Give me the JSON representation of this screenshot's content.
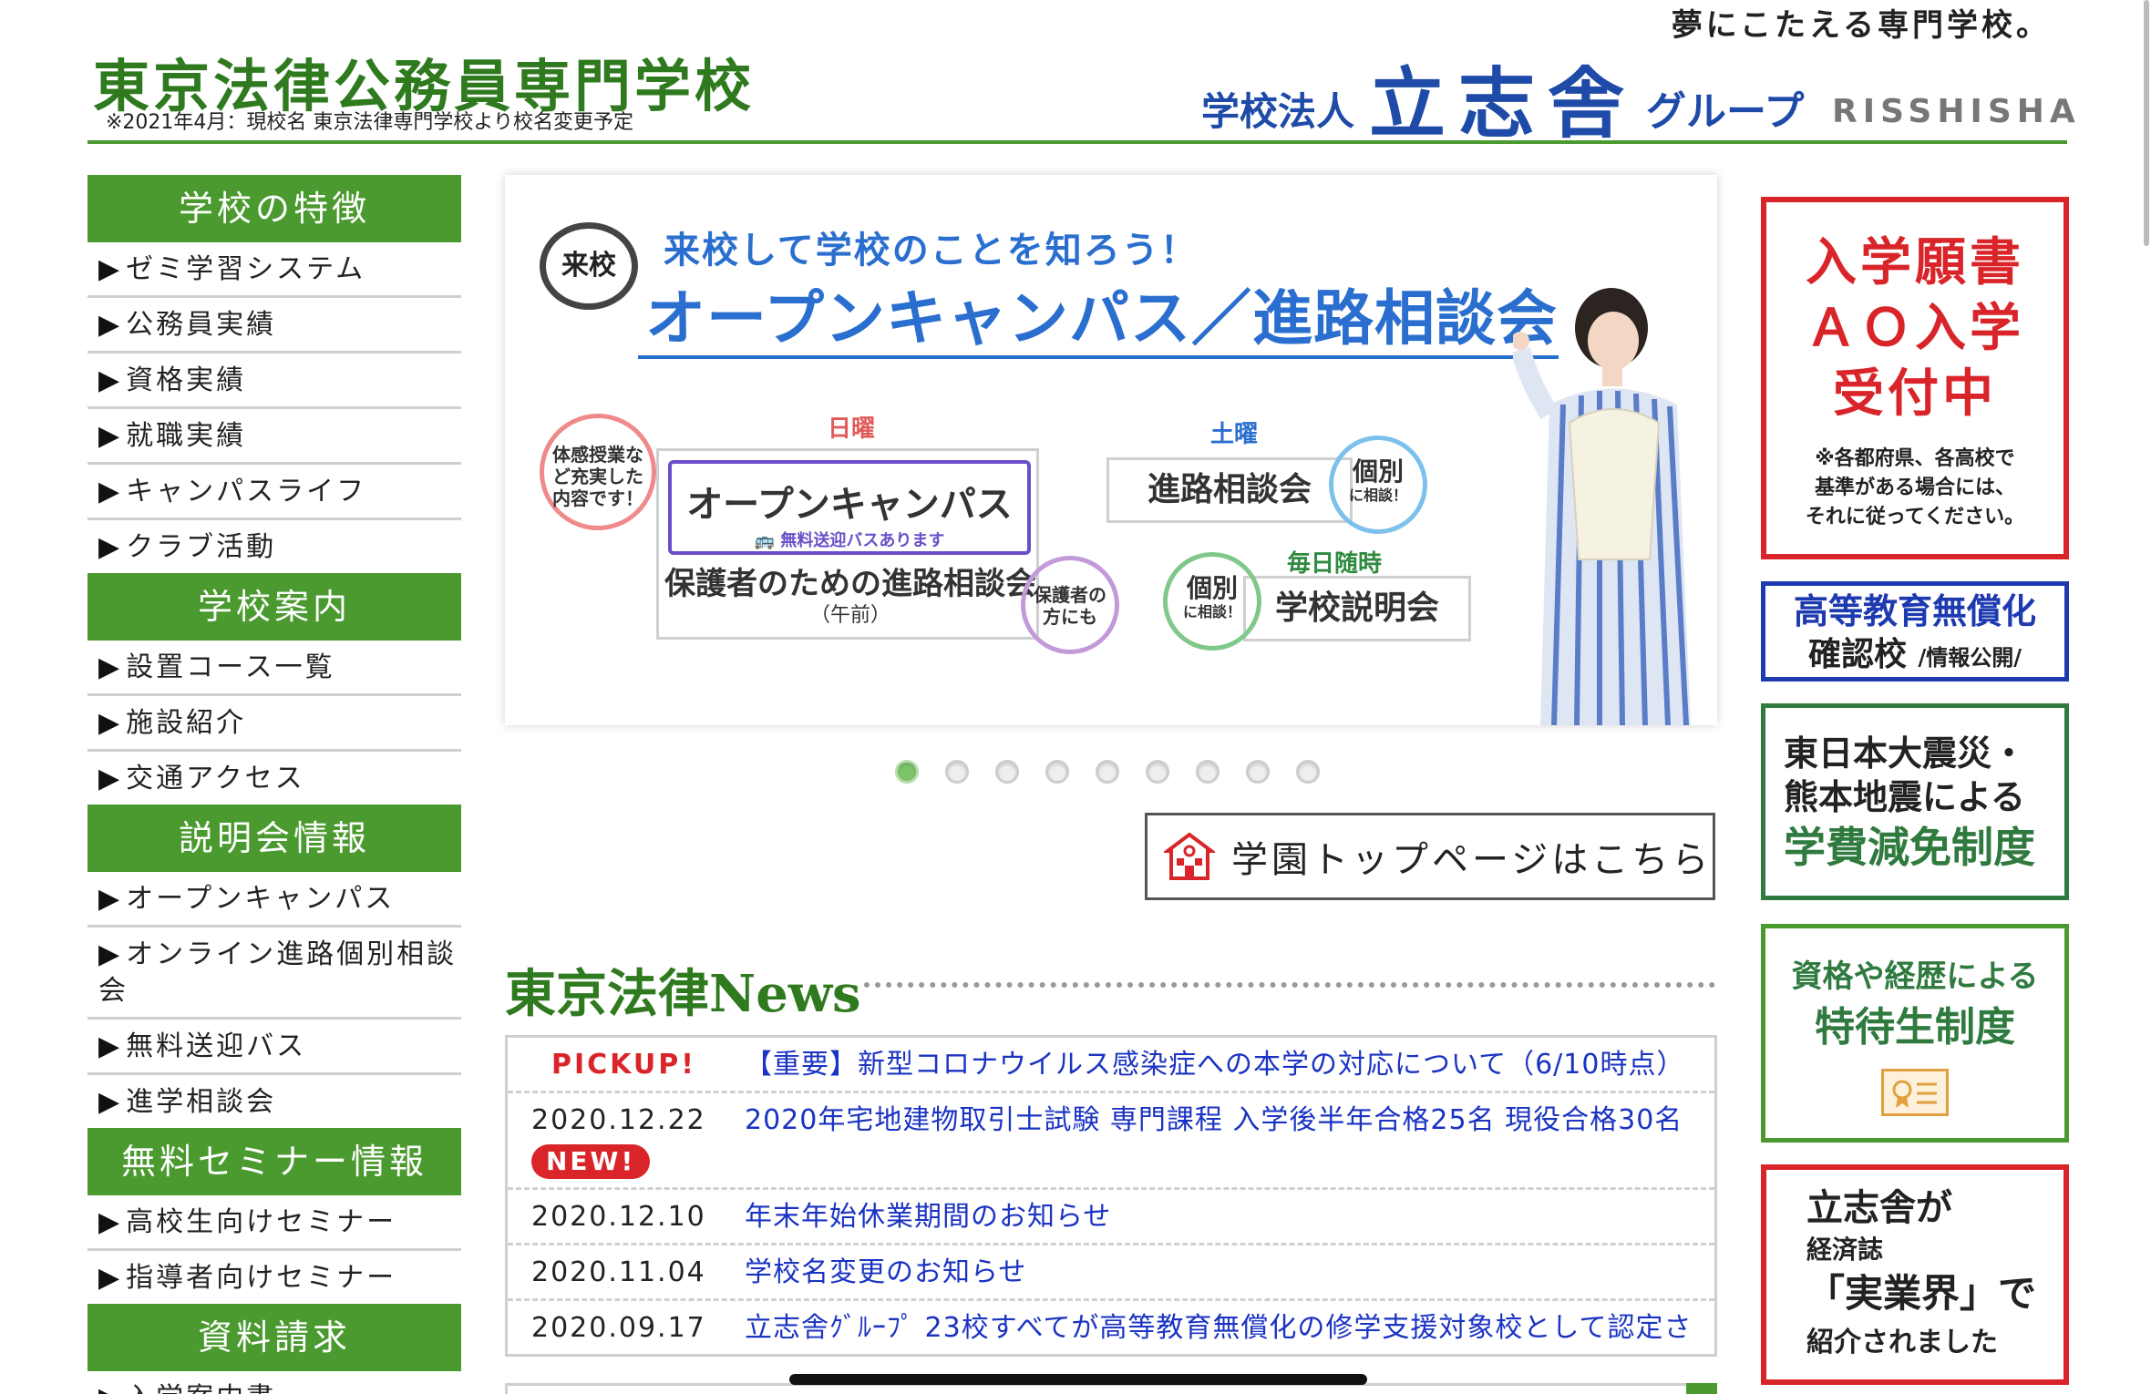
{
  "header": {
    "tagline": "夢にこたえる専門学校。",
    "school_name": "東京法律公務員専門学校",
    "school_note": "※2021年4月：現校名 東京法律専門学校より校名変更予定",
    "corp_prefix": "学校法人",
    "corp_name": "立志舎",
    "corp_suffix": "グループ",
    "corp_en": "RISSHISHA"
  },
  "sidebar": {
    "sections": [
      {
        "heading": "学校の特徴",
        "items": [
          "ゼミ学習システム",
          "公務員実績",
          "資格実績",
          "就職実績",
          "キャンパスライフ",
          "クラブ活動"
        ]
      },
      {
        "heading": "学校案内",
        "items": [
          "設置コース一覧",
          "施設紹介",
          "交通アクセス"
        ]
      },
      {
        "heading": "説明会情報",
        "items": [
          "オープンキャンパス",
          "オンライン進路個別相談会",
          "無料送迎バス",
          "進学相談会"
        ]
      },
      {
        "heading": "無料セミナー情報",
        "items": [
          "高校生向けセミナー",
          "指導者向けセミナー"
        ]
      },
      {
        "heading": "資料請求",
        "items": [
          "入学案内書"
        ]
      }
    ]
  },
  "slide": {
    "bubble": "来校",
    "subtitle": "来校して学校のことを知ろう！",
    "title": "オープンキャンパス／進路相談会",
    "sunday": "日曜",
    "saturday": "土曜",
    "everyday": "毎日随時",
    "open_campus": "オープンキャンパス",
    "bus_note": "無料送迎バスあります",
    "guardian_session": "保護者のための進路相談会",
    "guardian_time": "（午前）",
    "trial_circle": "体感授業など充実した内容です！",
    "guardian_circle": "保護者の方にも",
    "career_consult": "進路相談会",
    "individual_main": "個別",
    "individual_sub": "に相談！",
    "school_briefing": "学校説明会"
  },
  "slider_dots": {
    "count": 9,
    "active_index": 0
  },
  "top_page_button": {
    "label": "学園トップページはこちら",
    "icon": "school-building-icon"
  },
  "news": {
    "title": "東京法律News",
    "pickup_label": "PICKUP!",
    "new_label": "NEW!",
    "items": [
      {
        "date": "PICKUP!",
        "text": "【重要】新型コロナウイルス感染症への本学の対応について（6/10時点）",
        "is_pickup": true,
        "is_new": false
      },
      {
        "date": "2020.12.22",
        "text": "2020年宅地建物取引士試験 専門課程 入学後半年合格25名 現役合格30名",
        "is_pickup": false,
        "is_new": true
      },
      {
        "date": "2020.12.10",
        "text": "年末年始休業期間のお知らせ",
        "is_pickup": false,
        "is_new": false
      },
      {
        "date": "2020.11.04",
        "text": "学校名変更のお知らせ",
        "is_pickup": false,
        "is_new": false
      },
      {
        "date": "2020.09.17",
        "text": "立志舎ｸﾞﾙｰﾌﾟ 23校すべてが高等教育無償化の修学支援対象校として認定さ",
        "is_pickup": false,
        "is_new": false
      }
    ]
  },
  "banners": {
    "apply": {
      "line1": "入学願書",
      "line2": "ＡＯ入学",
      "line3": "受付中",
      "note1": "※各都府県、各高校で",
      "note2": "基準がある場合には、",
      "note3": "それに従ってください。"
    },
    "free_tuition": {
      "line1": "高等教育無償化",
      "line2": "確認校",
      "line2_sub": "/情報公開/"
    },
    "earthquake": {
      "line1": "東日本大震災・",
      "line2": "熊本地震による",
      "line3": "学費減免制度"
    },
    "special": {
      "line1": "資格や経歴による",
      "line2": "特待生制度"
    },
    "media": {
      "line1": "立志舎が",
      "line2": "経済誌",
      "line3": "「実業界」で",
      "line4": "紹介されました"
    }
  },
  "colors": {
    "green": "#4a9a2f",
    "dark_green": "#2f7a1f",
    "blue": "#1e4aa8",
    "red": "#d9252a",
    "link_blue": "#1a33c2"
  }
}
